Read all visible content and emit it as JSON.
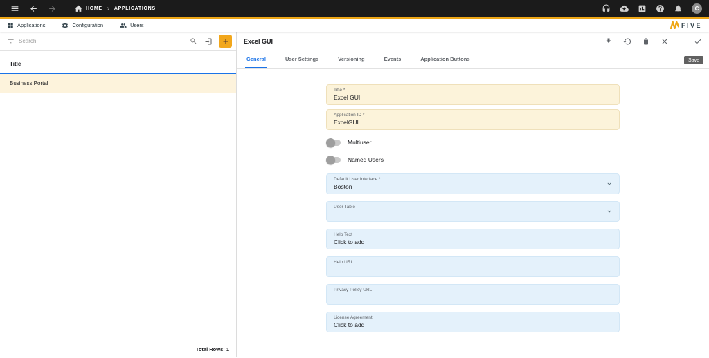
{
  "colors": {
    "accent_gold": "#EFA817",
    "active_tab_blue": "#1A73E8",
    "field_cream": "#FCF3DA",
    "field_blue": "#E4F1FB",
    "topbar_black": "#1B1B1B"
  },
  "topbar": {
    "breadcrumb": {
      "home": "HOME",
      "section": "APPLICATIONS"
    },
    "avatar_initial": "C"
  },
  "menubar": {
    "items": [
      {
        "label": "Applications"
      },
      {
        "label": "Configuration"
      },
      {
        "label": "Users"
      }
    ],
    "logo_text": "FIVE"
  },
  "left_panel": {
    "search_placeholder": "Search",
    "table": {
      "header": "Title",
      "rows": [
        {
          "title": "Business Portal"
        }
      ]
    },
    "footer": "Total Rows: 1"
  },
  "main": {
    "title": "Excel GUI",
    "save_tooltip": "Save",
    "tabs": [
      {
        "label": "General",
        "active": true
      },
      {
        "label": "User Settings",
        "active": false
      },
      {
        "label": "Versioning",
        "active": false
      },
      {
        "label": "Events",
        "active": false
      },
      {
        "label": "Application Buttons",
        "active": false
      }
    ],
    "form": {
      "fields": [
        {
          "label": "Title *",
          "value": "Excel GUI",
          "type": "text",
          "bg": "cream"
        },
        {
          "label": "Application ID *",
          "value": "ExcelGUI",
          "type": "text",
          "bg": "cream"
        },
        {
          "label": "Default User Interface *",
          "value": "Boston",
          "type": "select",
          "bg": "blue"
        },
        {
          "label": "User Table",
          "value": "",
          "type": "select",
          "bg": "blue"
        },
        {
          "label": "Help Text",
          "value": "Click to add",
          "type": "text",
          "bg": "blue"
        },
        {
          "label": "Help URL",
          "value": "",
          "type": "text",
          "bg": "blue"
        },
        {
          "label": "Privacy Policy URL",
          "value": "",
          "type": "text",
          "bg": "blue"
        },
        {
          "label": "License Agreement",
          "value": "Click to add",
          "type": "text",
          "bg": "blue"
        }
      ],
      "toggles": [
        {
          "label": "Multiuser",
          "on": false
        },
        {
          "label": "Named Users",
          "on": false
        }
      ]
    }
  },
  "icons": {
    "topbar_left": [
      "menu-icon",
      "back-arrow-icon",
      "forward-arrow-icon",
      "home-icon"
    ],
    "topbar_right": [
      "support-headset-icon",
      "cloud-upload-icon",
      "usage-chart-icon",
      "help-icon",
      "notifications-bell-icon",
      "avatar"
    ],
    "menubar": [
      "applications-grid-icon",
      "configuration-gear-icon",
      "users-people-icon",
      "five-logo"
    ],
    "left_panel": [
      "filter-icon",
      "search-icon",
      "import-icon",
      "add-plus-icon"
    ],
    "detail_header": [
      "download-icon",
      "history-icon",
      "delete-icon",
      "close-icon",
      "save-check-icon"
    ],
    "fields": [
      "chevron-down-icon"
    ]
  }
}
